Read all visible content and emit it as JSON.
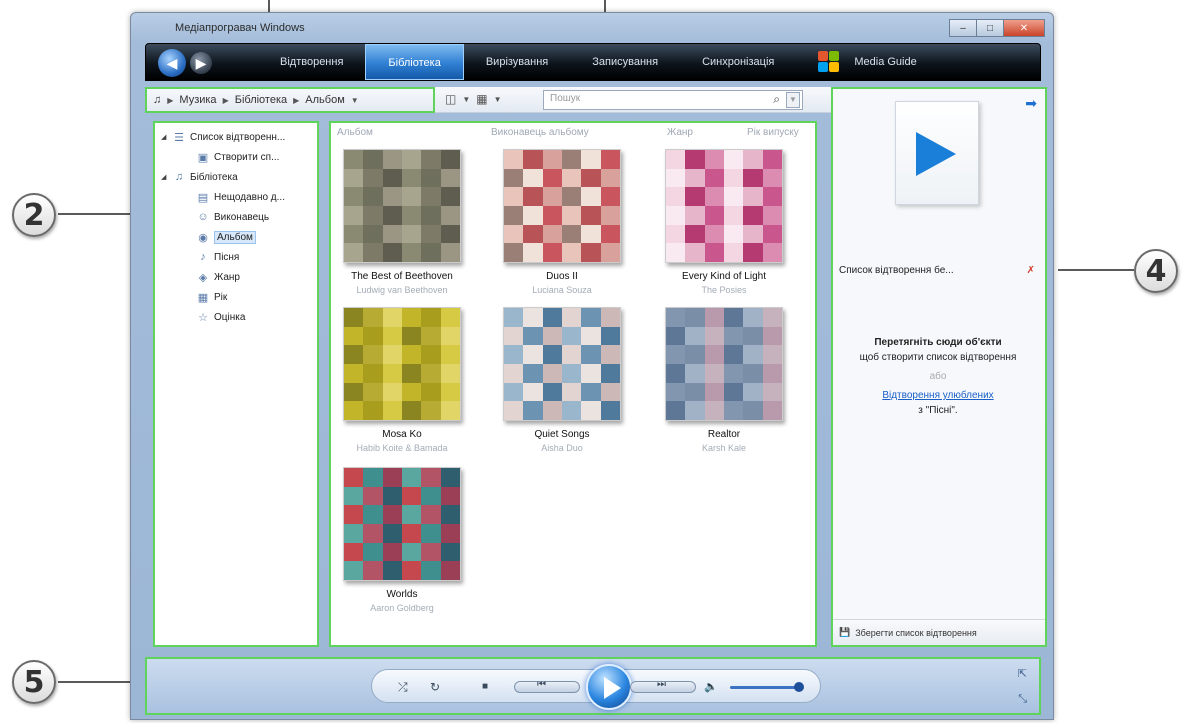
{
  "callouts": [
    "2",
    "4",
    "5"
  ],
  "window": {
    "title": "Медіапрогравач Windows",
    "controls": [
      "–",
      "□",
      "✕"
    ]
  },
  "nav": {
    "tabs": [
      "Відтворення",
      "Бібліотека",
      "Вирізування",
      "Записування",
      "Синхронізація"
    ],
    "active_tab": "Бібліотека",
    "media_guide": "Media Guide"
  },
  "toolbar": {
    "breadcrumb": [
      "Музика",
      "Бібліотека",
      "Альбом"
    ],
    "search_placeholder": "Пошук"
  },
  "navpane": {
    "items": [
      {
        "label": "Список відтворенн...",
        "level": 0,
        "icon": "playlist-icon"
      },
      {
        "label": "Створити сп...",
        "level": 1,
        "icon": "new-playlist-icon"
      },
      {
        "label": "Бібліотека",
        "level": 0,
        "icon": "music-note-icon"
      },
      {
        "label": "Нещодавно д...",
        "level": 1,
        "icon": "recent-icon"
      },
      {
        "label": "Виконавець",
        "level": 1,
        "icon": "artist-icon"
      },
      {
        "label": "Альбом",
        "level": 1,
        "icon": "album-icon",
        "selected": true
      },
      {
        "label": "Пісня",
        "level": 1,
        "icon": "song-icon"
      },
      {
        "label": "Жанр",
        "level": 1,
        "icon": "genre-icon"
      },
      {
        "label": "Рік",
        "level": 1,
        "icon": "year-icon"
      },
      {
        "label": "Оцінка",
        "level": 1,
        "icon": "rating-icon"
      }
    ]
  },
  "content": {
    "columns": [
      "Альбом",
      "Виконавець альбому",
      "Жанр",
      "Рік випуску"
    ],
    "albums": [
      {
        "title": "The Best of Beethoven",
        "artist": "Ludwig van Beethoven",
        "palette": [
          "#8a8a72",
          "#6f6f5e",
          "#9b9684",
          "#a8a58f",
          "#7d7b68",
          "#5f5d4f"
        ]
      },
      {
        "title": "Duos II",
        "artist": "Luciana Souza",
        "palette": [
          "#c9565e",
          "#e8c4bb",
          "#b85357",
          "#d9a19c",
          "#9a7f76",
          "#f0e2d9"
        ]
      },
      {
        "title": "Every Kind of Light",
        "artist": "The Posies",
        "palette": [
          "#e7b5c9",
          "#c9578d",
          "#f3d6e1",
          "#b63a72",
          "#dc8cb0",
          "#f8eaf0"
        ]
      },
      {
        "title": "Mosa Ko",
        "artist": "Habib Koite & Bamada",
        "palette": [
          "#c2b52a",
          "#a89d1c",
          "#d6ca45",
          "#8a8520",
          "#b7ab33",
          "#e0d566"
        ]
      },
      {
        "title": "Quiet Songs",
        "artist": "Aisha Duo",
        "palette": [
          "#4f7a9c",
          "#e2d5d1",
          "#6d93b2",
          "#cdb8b8",
          "#9ab6cc",
          "#eae3df"
        ]
      },
      {
        "title": "Realtor",
        "artist": "Karsh Kale",
        "palette": [
          "#7a8ea8",
          "#b89aac",
          "#5e7796",
          "#a2b2c6",
          "#c6b2bd",
          "#8296b0"
        ]
      },
      {
        "title": "Worlds",
        "artist": "Aaron Goldberg",
        "palette": [
          "#c6484f",
          "#3f8f8f",
          "#9a3f55",
          "#5aa7a0",
          "#b25466",
          "#2f5f6f"
        ]
      }
    ]
  },
  "listpane": {
    "header": "Список відтворення бе...",
    "message_bold": "Перетягніть сюди об'єкти",
    "message": "щоб створити список відтворення",
    "or": "або",
    "link": "Відтворення улюблених",
    "link_suffix": "з \"Пісні\".",
    "save_label": "Зберегти список відтворення"
  },
  "player": {
    "shuffle": "⤮",
    "repeat": "↻",
    "stop": "■",
    "prev": "⏮",
    "next": "⏭",
    "volume": "🔈"
  }
}
